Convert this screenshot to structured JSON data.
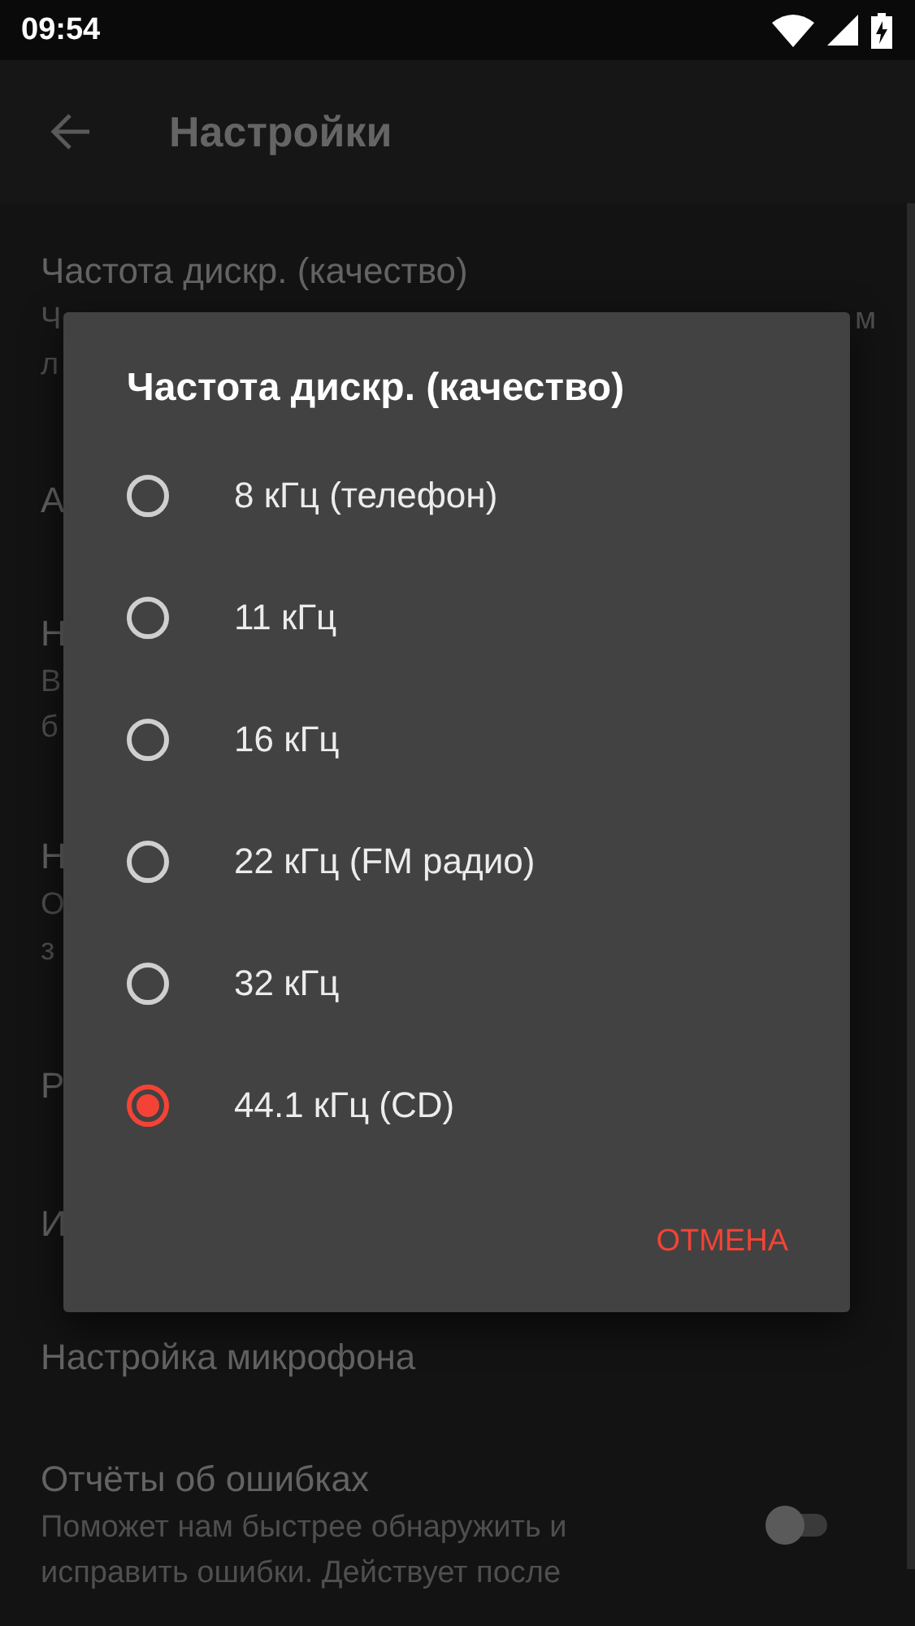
{
  "status_bar": {
    "time": "09:54"
  },
  "toolbar": {
    "title": "Настройки"
  },
  "settings": [
    {
      "title": "Частота дискр. (качество)",
      "summary": [
        {
          "start": "Ч",
          "end": "м"
        },
        {
          "start": "л"
        }
      ]
    },
    {
      "title": "А"
    },
    {
      "title": "Н",
      "summary": [
        {
          "start": "В"
        },
        {
          "start": "б"
        }
      ]
    },
    {
      "title": "Н",
      "summary": [
        {
          "start": "О"
        },
        {
          "start": "з"
        }
      ]
    },
    {
      "title": "Р"
    },
    {
      "title": "И"
    },
    {
      "title": "Настройка микрофона"
    },
    {
      "title": "Отчёты об ошибках",
      "summary": [
        {
          "start": "Поможет нам быстрее обнаружить и"
        },
        {
          "start": "исправить ошибки. Действует после"
        }
      ],
      "switch": {
        "on": false
      }
    }
  ],
  "dialog": {
    "title": "Частота дискр. (качество)",
    "options": [
      {
        "label": "8 кГц (телефон)",
        "selected": false
      },
      {
        "label": "11 кГц",
        "selected": false
      },
      {
        "label": "16 кГц",
        "selected": false
      },
      {
        "label": "22 кГц (FM радио)",
        "selected": false
      },
      {
        "label": "32 кГц",
        "selected": false
      },
      {
        "label": "44.1 кГц (CD)",
        "selected": true
      }
    ],
    "cancel": "ОТМЕНА"
  }
}
